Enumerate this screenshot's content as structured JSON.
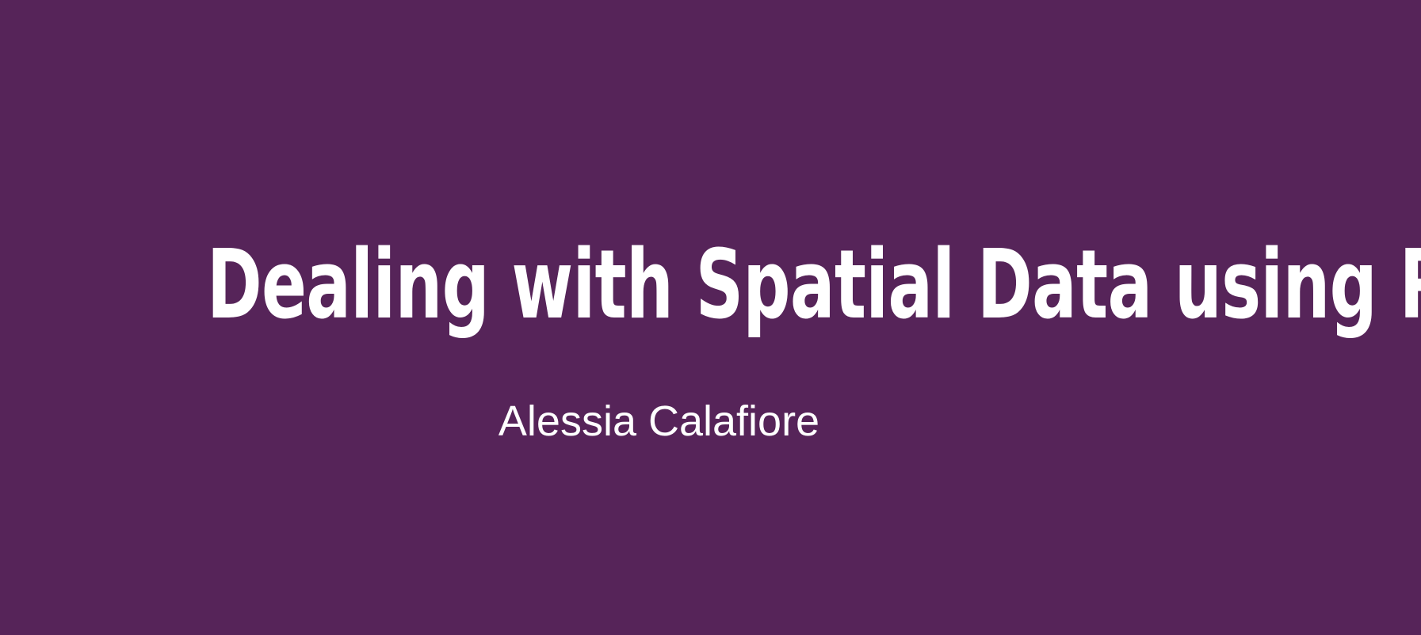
{
  "slide": {
    "title": "Dealing with Spatial Data using R",
    "author": "Alessia Calafiore"
  },
  "colors": {
    "background": "#562459",
    "text": "#ffffff"
  }
}
